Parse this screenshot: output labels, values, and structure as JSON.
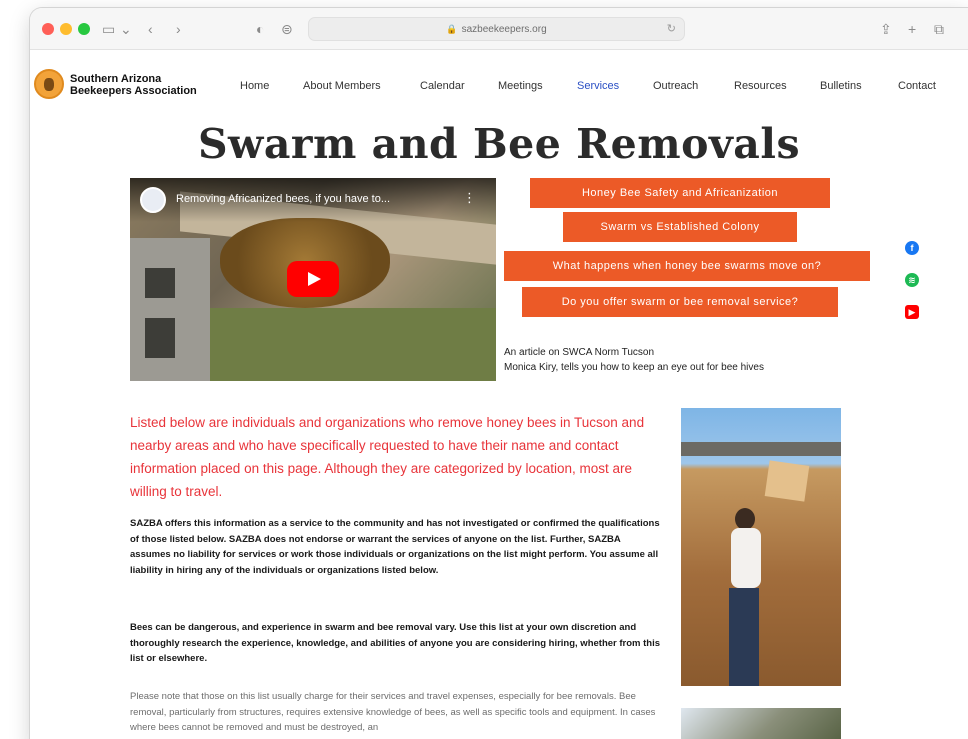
{
  "browser": {
    "url": "sazbeekeepers.org",
    "icons": [
      "sidebar-icon",
      "back-icon",
      "forward-icon",
      "privacy-icon",
      "extension-icon",
      "reload-icon",
      "share-icon",
      "new-tab-icon",
      "tabs-icon"
    ]
  },
  "site": {
    "org_name_line1": "Southern Arizona",
    "org_name_line2": "Beekeepers Association",
    "nav": [
      {
        "label": "Home"
      },
      {
        "label": "About Members"
      },
      {
        "label": "Calendar"
      },
      {
        "label": "Meetings"
      },
      {
        "label": "Services",
        "active": true
      },
      {
        "label": "Outreach"
      },
      {
        "label": "Resources"
      },
      {
        "label": "Bulletins"
      },
      {
        "label": "Contact"
      }
    ]
  },
  "page": {
    "title": "Swarm and Bee Removals",
    "video": {
      "title": "Removing Africanized bees, if you have to..."
    },
    "buttons": [
      "Honey Bee Safety and Africanization",
      "Swarm vs Established Colony",
      "What happens when honey bee swarms move on?",
      "Do you offer swarm or bee removal service?"
    ],
    "caption_line1": "An article on SWCA Norm Tucson",
    "caption_line2": "Monica Kiry, tells you how to keep an eye out for bee hives",
    "intro": "Listed below are individuals and organizations who remove honey bees in Tucson and nearby areas and who have specifically requested to have their name and contact information placed on this page. Although they are categorized by location, most are willing to travel.",
    "para1": "SAZBA offers this information as a service to the community and has not investigated or confirmed the qualifications of those listed below. SAZBA does not endorse or warrant the services of anyone on the list. Further, SAZBA assumes no liability for services or work those individuals or organizations on the list might perform. You assume all liability in hiring any of the individuals or organizations listed below.",
    "para2": "Bees can be dangerous, and experience in swarm and bee removal vary. Use this list at your own discretion and thoroughly research the experience, knowledge, and abilities of anyone you are considering hiring, whether from this list or elsewhere.",
    "para3": "Please note that those on this list usually charge for their services and travel expenses, especially for bee removals. Bee removal, particularly from structures, requires extensive knowledge of bees, as well as specific tools and equipment. In cases where bees cannot be removed and must be destroyed, an"
  },
  "colors": {
    "accent": "#ec5a27",
    "intro_text": "#e8343a",
    "active_nav": "#2a4fc4"
  }
}
